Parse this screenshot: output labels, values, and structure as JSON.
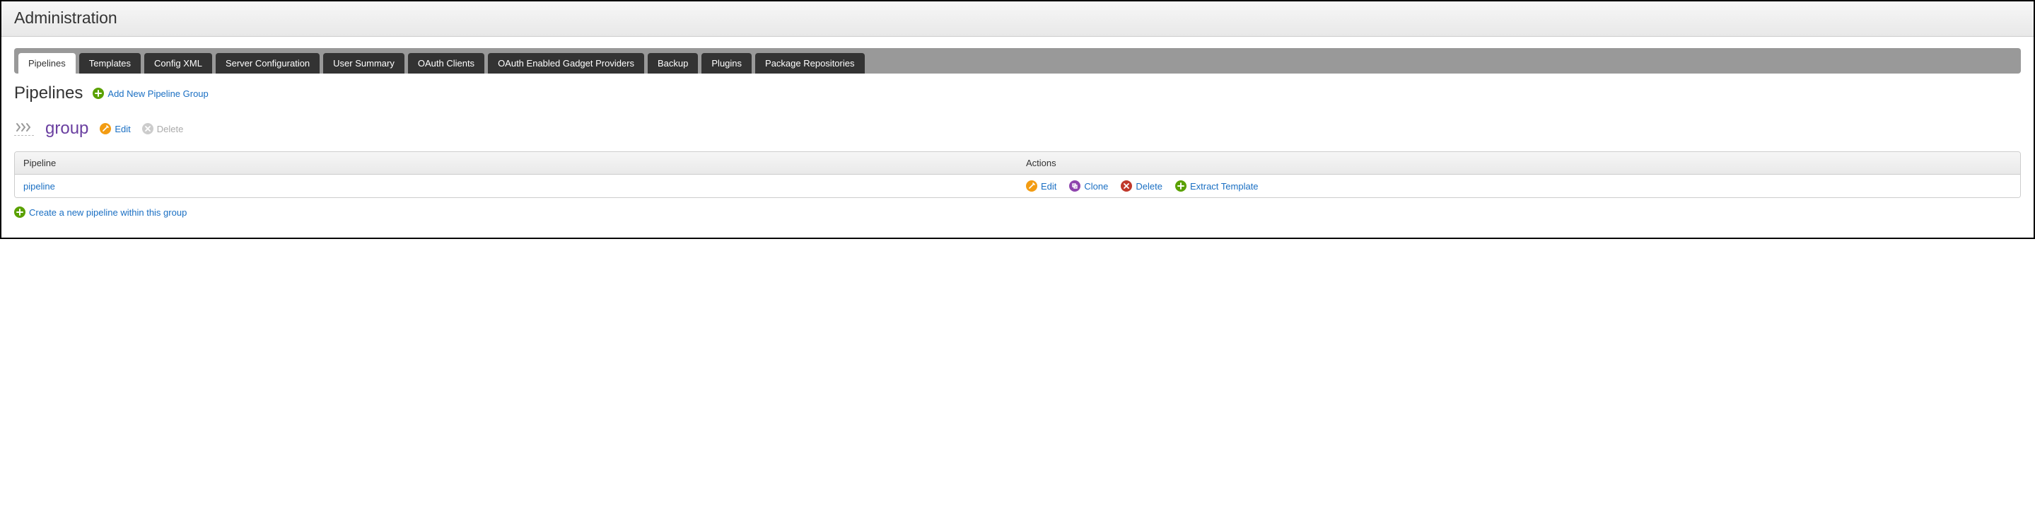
{
  "header": {
    "title": "Administration"
  },
  "tabs": [
    {
      "label": "Pipelines",
      "active": true
    },
    {
      "label": "Templates"
    },
    {
      "label": "Config XML"
    },
    {
      "label": "Server Configuration"
    },
    {
      "label": "User Summary"
    },
    {
      "label": "OAuth Clients"
    },
    {
      "label": "OAuth Enabled Gadget Providers"
    },
    {
      "label": "Backup"
    },
    {
      "label": "Plugins"
    },
    {
      "label": "Package Repositories"
    }
  ],
  "section": {
    "title": "Pipelines",
    "add_group_label": "Add New Pipeline Group"
  },
  "group": {
    "name": "group",
    "edit_label": "Edit",
    "delete_label": "Delete",
    "delete_enabled": false
  },
  "table": {
    "headers": {
      "pipeline": "Pipeline",
      "actions": "Actions"
    },
    "rows": [
      {
        "name": "pipeline",
        "actions": {
          "edit": "Edit",
          "clone": "Clone",
          "delete": "Delete",
          "extract": "Extract Template"
        }
      }
    ]
  },
  "create_label": "Create a new pipeline within this group"
}
